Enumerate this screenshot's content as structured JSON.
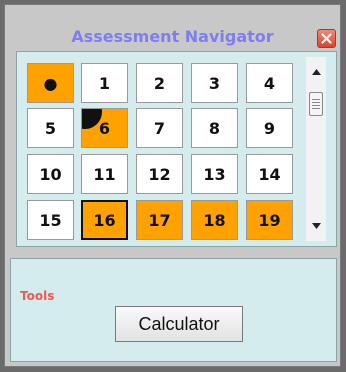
{
  "window": {
    "title": "Assessment Navigator"
  },
  "navigator": {
    "cells": [
      {
        "label": "●",
        "state": "answered"
      },
      {
        "label": "1",
        "state": "unanswered"
      },
      {
        "label": "2",
        "state": "unanswered"
      },
      {
        "label": "3",
        "state": "unanswered"
      },
      {
        "label": "4",
        "state": "unanswered"
      },
      {
        "label": "5",
        "state": "unanswered"
      },
      {
        "label": "6",
        "state": "answered",
        "flagged": true
      },
      {
        "label": "7",
        "state": "unanswered"
      },
      {
        "label": "8",
        "state": "unanswered"
      },
      {
        "label": "9",
        "state": "unanswered"
      },
      {
        "label": "10",
        "state": "unanswered"
      },
      {
        "label": "11",
        "state": "unanswered"
      },
      {
        "label": "12",
        "state": "unanswered"
      },
      {
        "label": "13",
        "state": "unanswered"
      },
      {
        "label": "14",
        "state": "unanswered"
      },
      {
        "label": "15",
        "state": "unanswered"
      },
      {
        "label": "16",
        "state": "answered",
        "current": true
      },
      {
        "label": "17",
        "state": "answered"
      },
      {
        "label": "18",
        "state": "answered"
      },
      {
        "label": "19",
        "state": "answered"
      }
    ]
  },
  "tools": {
    "label": "Tools",
    "calculator_label": "Calculator"
  },
  "colors": {
    "answered": "#ffa200",
    "unanswered": "#ffffff",
    "title": "#7e7ef2",
    "tools_label": "#f05a4a",
    "panel": "#d4ecee"
  },
  "icons": {
    "close": "close-icon",
    "scroll_up": "chevron-up-icon",
    "scroll_down": "chevron-down-icon",
    "flag": "flag-corner-icon"
  }
}
